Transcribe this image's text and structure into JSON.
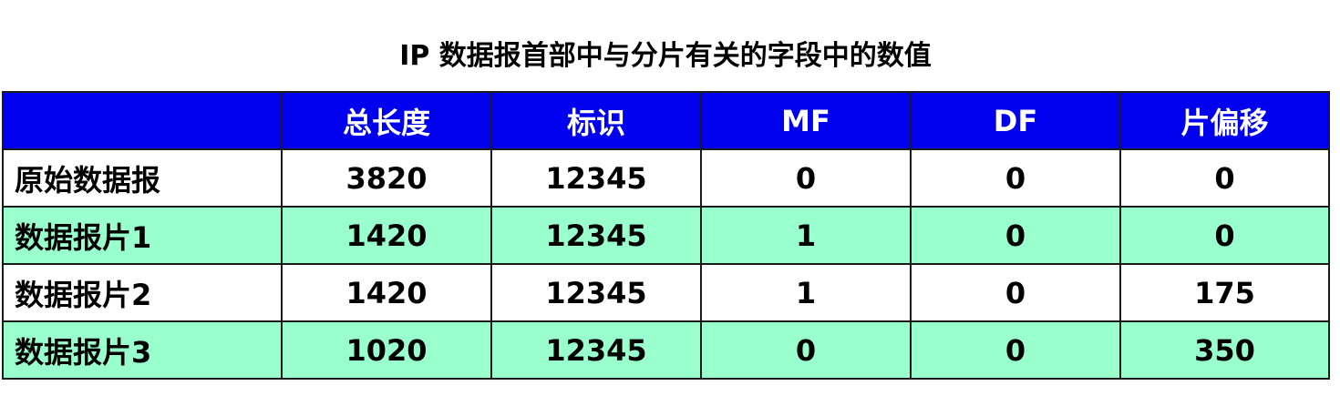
{
  "title": "IP 数据报首部中与分片有关的字段中的数值",
  "colors": {
    "header_bg": "#0000ee",
    "header_text": "#ffffff",
    "shaded_row_bg": "#99ffcc",
    "plain_row_bg": "#ffffff",
    "border": "#1a1a1a"
  },
  "table": {
    "headers": [
      "",
      "总长度",
      "标识",
      "MF",
      "DF",
      "片偏移"
    ],
    "rows": [
      {
        "label": "原始数据报",
        "cells": [
          "3820",
          "12345",
          "0",
          "0",
          "0"
        ]
      },
      {
        "label": "数据报片1",
        "cells": [
          "1420",
          "12345",
          "1",
          "0",
          "0"
        ]
      },
      {
        "label": "数据报片2",
        "cells": [
          "1420",
          "12345",
          "1",
          "0",
          "175"
        ]
      },
      {
        "label": "数据报片3",
        "cells": [
          "1020",
          "12345",
          "0",
          "0",
          "350"
        ]
      }
    ]
  }
}
